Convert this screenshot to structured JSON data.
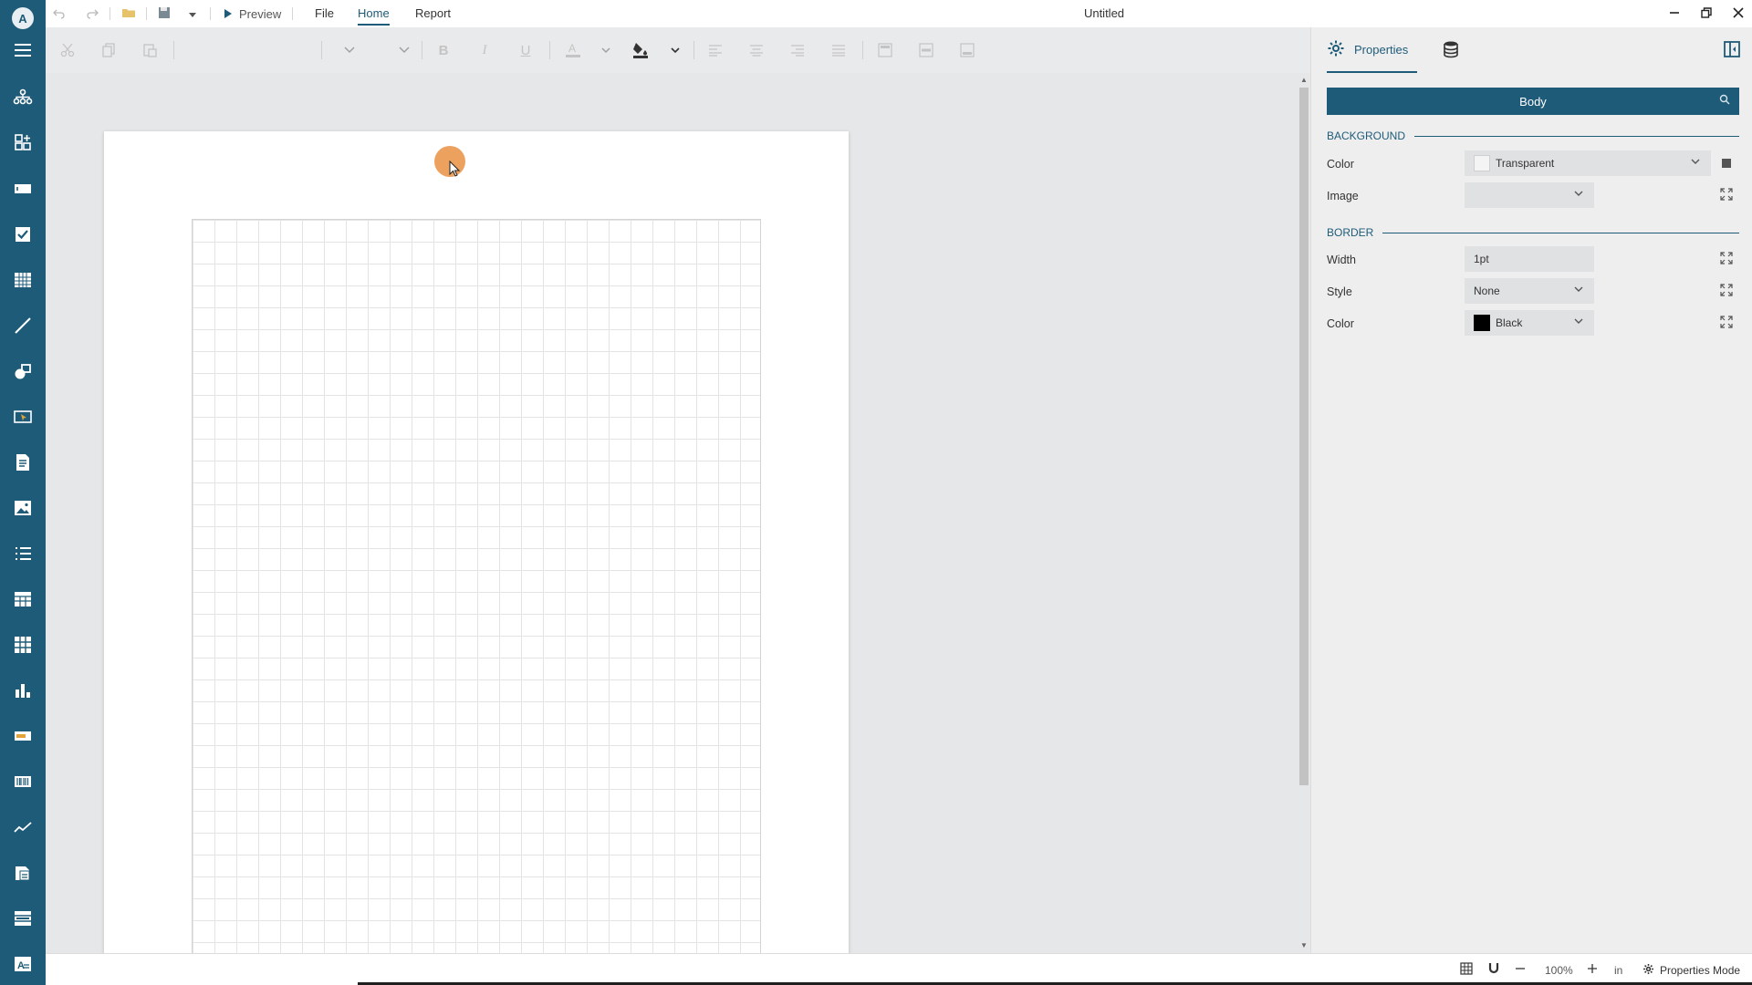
{
  "app": {
    "logo_glyph": "A",
    "document_title": "Untitled",
    "accent_color": "#1e5b78"
  },
  "titlebar": {
    "preview_label": "Preview",
    "menu_tabs": [
      {
        "label": "File",
        "active": false
      },
      {
        "label": "Home",
        "active": true
      },
      {
        "label": "Report",
        "active": false
      }
    ]
  },
  "sidebar": {
    "items": [
      {
        "icon": "menu-icon"
      },
      {
        "icon": "data-hierarchy-icon"
      },
      {
        "icon": "add-component-icon"
      },
      {
        "icon": "textbox-icon"
      },
      {
        "icon": "checkbox-icon"
      },
      {
        "icon": "tablix-icon"
      },
      {
        "icon": "line-icon"
      },
      {
        "icon": "shape-icon"
      },
      {
        "icon": "input-field-icon"
      },
      {
        "icon": "rich-text-icon"
      },
      {
        "icon": "image-icon"
      },
      {
        "icon": "list-icon"
      },
      {
        "icon": "table-icon"
      },
      {
        "icon": "matrix-icon"
      },
      {
        "icon": "chart-icon"
      },
      {
        "icon": "bullet-icon"
      },
      {
        "icon": "barcode-icon"
      },
      {
        "icon": "sparkline-icon"
      },
      {
        "icon": "subreport-icon"
      },
      {
        "icon": "banded-list-icon"
      },
      {
        "icon": "formatted-text-icon"
      }
    ]
  },
  "properties_panel": {
    "tab_label": "Properties",
    "selected_element": "Body",
    "sections": {
      "background": "BACKGROUND",
      "border": "BORDER"
    },
    "background": {
      "color_label": "Color",
      "color_value": "Transparent",
      "image_label": "Image",
      "image_value": ""
    },
    "border": {
      "width_label": "Width",
      "width_value": "1pt",
      "style_label": "Style",
      "style_value": "None",
      "color_label": "Color",
      "color_value": "Black",
      "color_swatch": "#000000"
    }
  },
  "statusbar": {
    "zoom": "100%",
    "unit": "in",
    "mode_label": "Properties Mode"
  }
}
